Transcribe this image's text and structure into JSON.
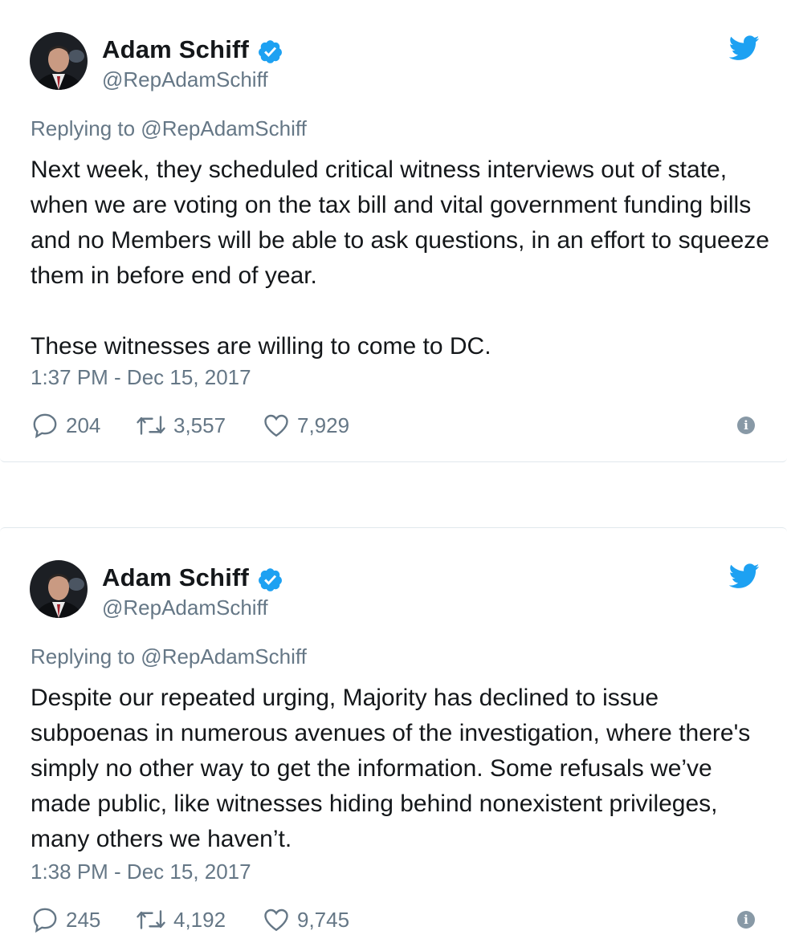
{
  "tweets": [
    {
      "author_name": "Adam Schiff",
      "handle": "@RepAdamSchiff",
      "replying_to": "Replying to @RepAdamSchiff",
      "paragraphs": [
        "Next week, they scheduled critical witness interviews out of state, when we are voting on the tax bill and vital government funding bills and no Members will be able to ask questions, in an effort to squeeze them in before end of year.",
        "These witnesses are willing to come to DC."
      ],
      "timestamp": "1:37 PM - Dec 15, 2017",
      "replies": "204",
      "retweets": "3,557",
      "likes": "7,929"
    },
    {
      "author_name": "Adam Schiff",
      "handle": "@RepAdamSchiff",
      "replying_to": "Replying to @RepAdamSchiff",
      "paragraphs": [
        "Despite our repeated urging, Majority has declined to issue subpoenas in numerous avenues of the investigation, where there's simply no other way to get the information. Some refusals we’ve made public, like witnesses hiding behind nonexistent privileges, many others we haven’t."
      ],
      "timestamp": "1:38 PM - Dec 15, 2017",
      "replies": "245",
      "retweets": "4,192",
      "likes": "9,745"
    }
  ],
  "icons": {
    "verified": "verified-badge-icon",
    "bird": "twitter-bird-icon",
    "reply": "reply-icon",
    "retweet": "retweet-icon",
    "like": "heart-icon",
    "info": "info-icon"
  },
  "colors": {
    "twitter_blue": "#1da1f2",
    "text_primary": "#14171a",
    "text_secondary": "#657786",
    "border": "#e1e8ed"
  }
}
